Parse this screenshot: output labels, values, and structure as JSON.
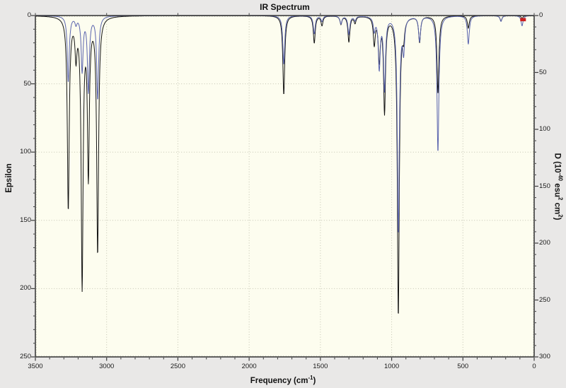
{
  "title": "IR Spectrum",
  "chart_data": {
    "type": "line",
    "title": "IR Spectrum",
    "xlabel_parts": [
      {
        "t": "Frequency (cm"
      },
      {
        "t": "-1",
        "sup": true
      },
      {
        "t": ")"
      }
    ],
    "ylabel_left": "Epsilon",
    "ylabel_right_parts": [
      {
        "t": "D (10"
      },
      {
        "t": "-40",
        "sup": true
      },
      {
        "t": " esu"
      },
      {
        "t": "2",
        "sup": true
      },
      {
        "t": " cm"
      },
      {
        "t": "2",
        "sup": true
      },
      {
        "t": ")"
      }
    ],
    "x_axis": {
      "min": 0,
      "max": 3500,
      "inverted": true,
      "major_ticks": [
        3500,
        3000,
        2500,
        2000,
        1500,
        1000,
        500,
        0
      ],
      "minor_step": 100
    },
    "y_axis_left": {
      "min": 0,
      "max": 250,
      "increases_downward": true,
      "major_ticks": [
        0,
        50,
        100,
        150,
        200,
        250
      ],
      "minor_step": 10
    },
    "y_axis_right": {
      "min": 0,
      "max": 300,
      "increases_downward": true,
      "major_ticks": [
        0,
        50,
        100,
        150,
        200,
        250,
        300
      ],
      "minor_step": 10
    },
    "grid": {
      "style": "dotted",
      "vertical_every": 500,
      "horizontal_every_left_units": 50
    },
    "peak_width_cm1": 8,
    "series": [
      {
        "name": "Epsilon",
        "axis": "left",
        "color": "#141414",
        "peaks": [
          [
            3269,
            141
          ],
          [
            3215,
            26
          ],
          [
            3172,
            196
          ],
          [
            3128,
            114
          ],
          [
            3063,
            173
          ],
          [
            1757,
            58
          ],
          [
            1543,
            20
          ],
          [
            1489,
            7
          ],
          [
            1356,
            6
          ],
          [
            1300,
            19
          ],
          [
            1257,
            5
          ],
          [
            1122,
            20
          ],
          [
            1087,
            31
          ],
          [
            1050,
            70
          ],
          [
            953,
            220
          ],
          [
            916,
            12
          ],
          [
            804,
            19
          ],
          [
            675,
            57
          ],
          [
            462,
            9
          ],
          [
            233,
            4
          ],
          [
            85,
            2
          ]
        ]
      },
      {
        "name": "D",
        "axis": "right",
        "color": "#5a64ae",
        "peaks": [
          [
            3269,
            58
          ],
          [
            3215,
            6
          ],
          [
            3172,
            48
          ],
          [
            3128,
            66
          ],
          [
            3063,
            73
          ],
          [
            1757,
            43
          ],
          [
            1543,
            16
          ],
          [
            1489,
            5
          ],
          [
            1356,
            7
          ],
          [
            1300,
            16
          ],
          [
            1257,
            4
          ],
          [
            1122,
            12
          ],
          [
            1087,
            45
          ],
          [
            1050,
            64
          ],
          [
            953,
            191
          ],
          [
            916,
            28
          ],
          [
            804,
            22
          ],
          [
            675,
            120
          ],
          [
            462,
            25
          ],
          [
            233,
            5
          ],
          [
            85,
            9
          ]
        ]
      }
    ],
    "annotations": [
      {
        "type": "red-marker",
        "freq": 78,
        "color": "#cc2020"
      }
    ]
  },
  "colors": {
    "page_background": "#e9e8e7",
    "plot_background": "#fdfdef",
    "grid": "#c4c4b2",
    "frame": "#3c3c3c",
    "epsilon_curve": "#141414",
    "d_curve": "#5a64ae",
    "marker_red": "#cc2020",
    "text": "#111111"
  }
}
